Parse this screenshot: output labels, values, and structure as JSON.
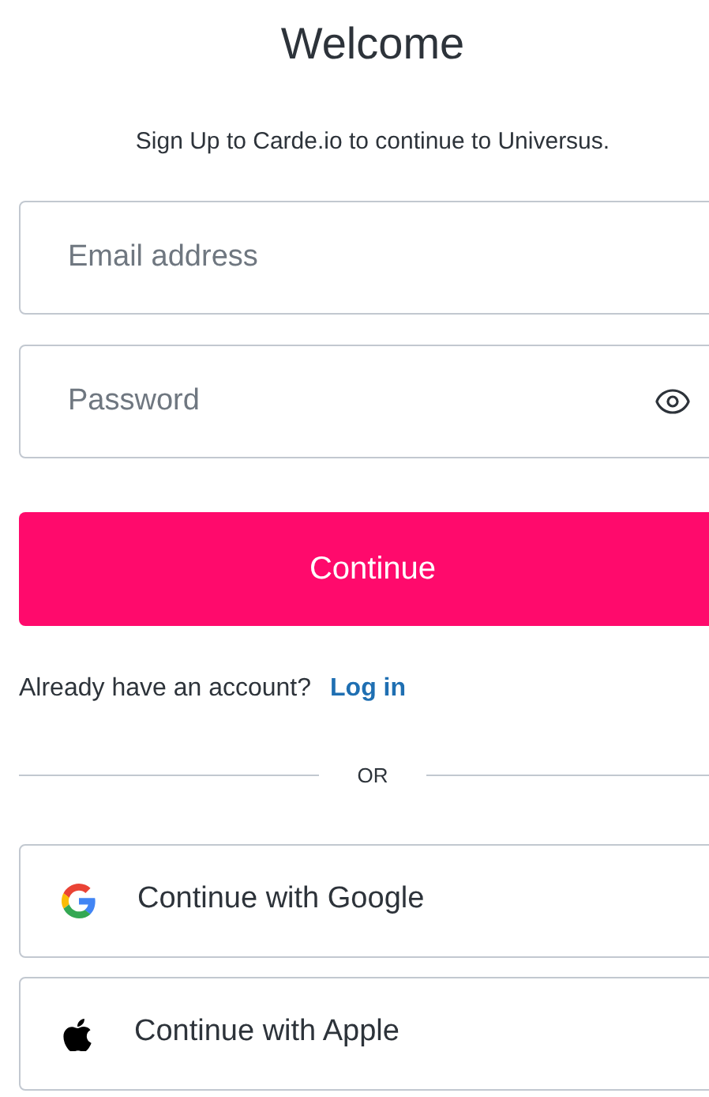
{
  "title": "Welcome",
  "subtitle": "Sign Up to Carde.io to continue to Universus.",
  "email": {
    "placeholder": "Email address"
  },
  "password": {
    "placeholder": "Password"
  },
  "continue_button": "Continue",
  "login_prompt": {
    "text": "Already have an account?",
    "link": "Log in"
  },
  "divider": "OR",
  "social_buttons": [
    {
      "kind": "google",
      "label": "Continue with Google"
    },
    {
      "kind": "apple",
      "label": "Continue with Apple"
    }
  ]
}
